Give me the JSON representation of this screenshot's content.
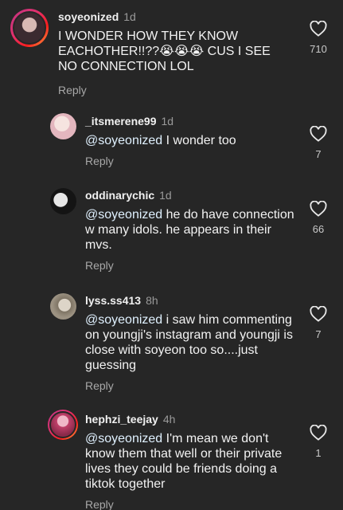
{
  "comments": [
    {
      "username": "soyeonized",
      "time": "1d",
      "mention": "",
      "text": "I WONDER HOW THEY KNOW EACHOTHER!!??😭😭😭 CUS I SEE NO CONNECTION LOL",
      "reply_label": "Reply",
      "likes": "710",
      "avatar_colors": [
        "#3b2a30",
        "#c8a8a8"
      ]
    },
    {
      "username": "_itsmerene99",
      "time": "1d",
      "mention": "@soyeonized",
      "text": " I wonder too",
      "reply_label": "Reply",
      "likes": "7",
      "avatar_colors": [
        "#e8c0c4",
        "#f4e0de"
      ]
    },
    {
      "username": "oddinarychic",
      "time": "1d",
      "mention": "@soyeonized",
      "text": " he do have connection w many idols. he appears in their mvs.",
      "reply_label": "Reply",
      "likes": "66",
      "avatar_colors": [
        "#1a1a1a",
        "#e8e8e8"
      ]
    },
    {
      "username": "lyss.ss413",
      "time": "8h",
      "mention": "@soyeonized",
      "text": " i saw him commenting on youngji's instagram and youngji is close with soyeon too so....just guessing",
      "reply_label": "Reply",
      "likes": "7",
      "avatar_colors": [
        "#8a8070",
        "#d8d0c0"
      ]
    },
    {
      "username": "hephzi_teejay",
      "time": "4h",
      "mention": "@soyeonized",
      "text": "  I'm mean we don't know them that well or their private lives they could be friends doing a tiktok together",
      "reply_label": "Reply",
      "likes": "1",
      "avatar_colors": [
        "#b04060",
        "#e890b0"
      ]
    }
  ]
}
